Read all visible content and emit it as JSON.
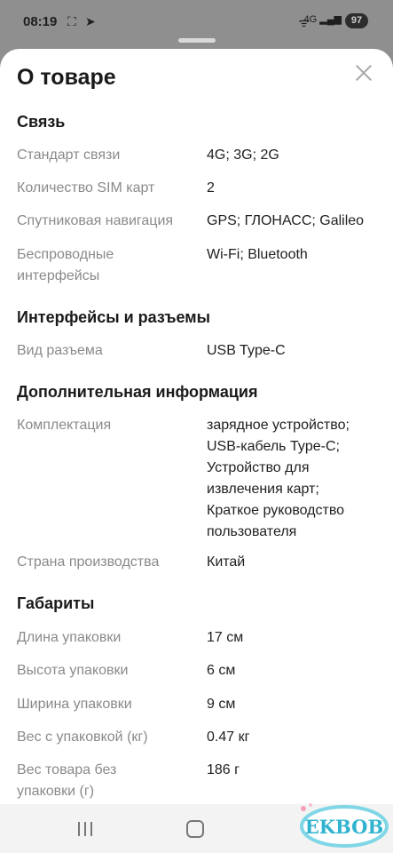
{
  "status_bar": {
    "time": "08:19",
    "network": "4G",
    "battery": "97"
  },
  "sheet": {
    "title": "О товаре",
    "sections": [
      {
        "title": "Связь",
        "rows": [
          {
            "label": [
              "Стандарт связи"
            ],
            "value": [
              "4G; 3G; 2G"
            ]
          },
          {
            "label": [
              "Количество SIM карт"
            ],
            "value": [
              "2"
            ]
          },
          {
            "label": [
              "Спутниковая навигация"
            ],
            "value": [
              "GPS; ГЛОНАСС; Galileo"
            ]
          },
          {
            "label": [
              "Беспроводные",
              "интерфейсы"
            ],
            "value": [
              "Wi-Fi; Bluetooth"
            ]
          }
        ]
      },
      {
        "title": "Интерфейсы и разъемы",
        "rows": [
          {
            "label": [
              "Вид разъема"
            ],
            "value": [
              "USB Type-C"
            ]
          }
        ]
      },
      {
        "title": "Дополнительная информация",
        "rows": [
          {
            "label": [
              "Комплектация"
            ],
            "value": [
              "зарядное устройство;",
              "USB-кабель Type-C;",
              "Устройство для",
              "извлечения карт;",
              "Краткое руководство",
              "пользователя"
            ]
          },
          {
            "label": [
              "Страна производства"
            ],
            "value": [
              "Китай"
            ]
          }
        ]
      },
      {
        "title": "Габариты",
        "rows": [
          {
            "label": [
              "Длина упаковки"
            ],
            "value": [
              "17 см"
            ]
          },
          {
            "label": [
              "Высота упаковки"
            ],
            "value": [
              "6 см"
            ]
          },
          {
            "label": [
              "Ширина упаковки"
            ],
            "value": [
              "9 см"
            ]
          },
          {
            "label": [
              "Вес с упаковкой (кг)"
            ],
            "value": [
              "0.47 кг"
            ]
          },
          {
            "label": [
              "Вес товара без",
              "упаковки (г)"
            ],
            "value": [
              "186 г"
            ]
          }
        ]
      }
    ]
  },
  "watermark": {
    "text": "EKBOB"
  }
}
